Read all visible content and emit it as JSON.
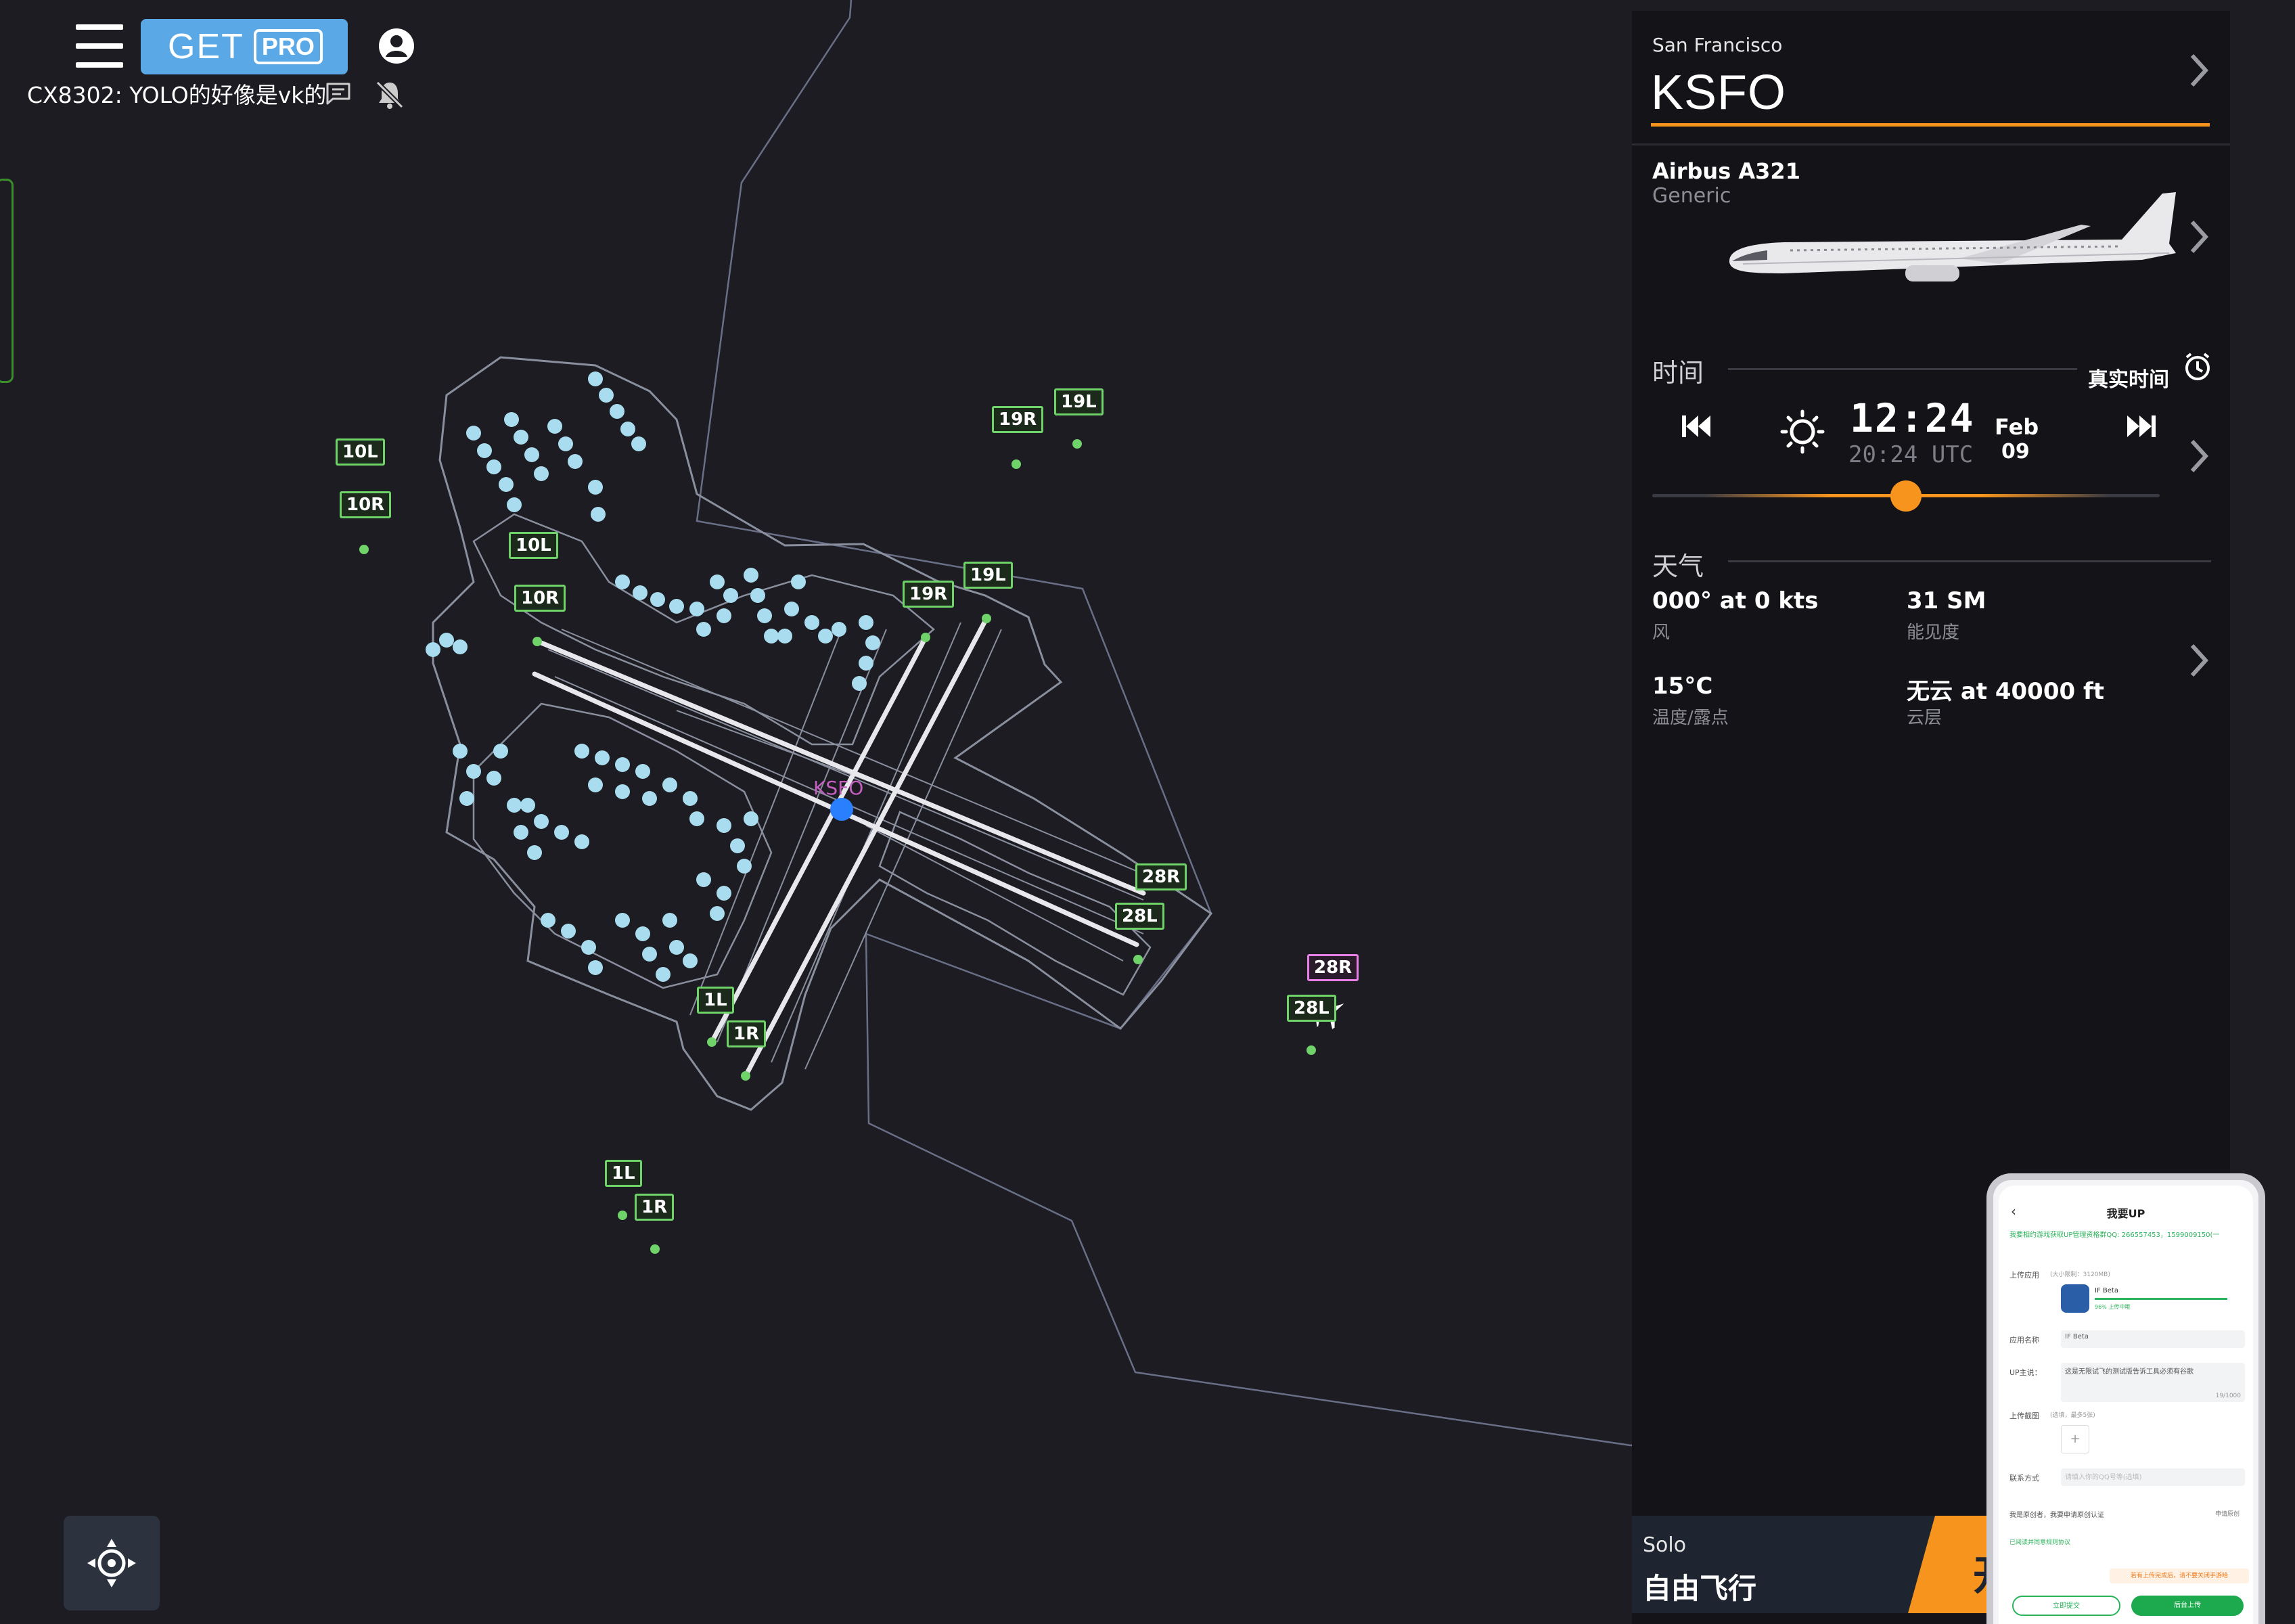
{
  "header": {
    "get_label": "GET",
    "pro_label": "PRO",
    "callsign_message": "CX8302: YOLO的好像是vk的"
  },
  "map": {
    "airport_label": "KSFO",
    "runway_labels": [
      "10L",
      "10R",
      "10L",
      "10R",
      "19R",
      "19L",
      "19R",
      "19L",
      "28R",
      "28L",
      "28R",
      "28L",
      "1L",
      "1R",
      "1L",
      "1R"
    ],
    "colors": {
      "background": "#1c1c22",
      "runway_label_border": "#6fd36a",
      "highlight_label_border": "#e87fe6",
      "terminal_gates": "#a9dcef",
      "airport_marker": "#2a7fff"
    }
  },
  "panel": {
    "city": "San Francisco",
    "icao": "KSFO",
    "aircraft_name": "Airbus A321",
    "aircraft_livery": "Generic",
    "time_section": "时间",
    "realtime_label": "真实时间",
    "local_time": "12:24",
    "utc_time": "20:24 UTC",
    "date_month": "Feb",
    "date_day": "09",
    "time_slider_fraction": 0.5,
    "weather_section": "天气",
    "wind_value": "000° at 0 kts",
    "wind_label": "风",
    "visibility_value": "31 SM",
    "visibility_label": "能见度",
    "temp_value": "15°C",
    "temp_label": "温度/露点",
    "cloud_value": "无云 at 40000 ft",
    "cloud_label": "云层",
    "accent_color": "#f7941d"
  },
  "solo": {
    "small": "Solo",
    "large": "自由飞行",
    "start_char": "开"
  },
  "phone": {
    "title": "我要UP",
    "back": "‹",
    "notice": "我要相约游戏获取UP管理资格群QQ: 266557453，1599009150(一",
    "upload_label": "上传应用",
    "upload_hint": "(大小限制：3120MB)",
    "app_name": "IF Beta",
    "progress_text": "96% 上传中哦",
    "name_label": "应用名称",
    "name_value": "IF Beta",
    "desc_label": "UP主说：",
    "desc_value": "这是无限试飞的测试版告诉工具必须有谷歌",
    "desc_count": "19/1000",
    "shot_label": "上传截图",
    "shot_hint": "(选填，最多5张)",
    "plus": "+",
    "contact_label": "联系方式",
    "contact_placeholder": "请填入你的QQ号等(选填)",
    "original_label": "我是原创者，我要申请原创认证",
    "original_right": "申请原创",
    "agree_text": "已阅读并同意规则协议",
    "orange_text": "若有上传完成后，请不要关闭手游哈",
    "btn_submit": "立即提交",
    "btn_bg": "后台上传"
  }
}
